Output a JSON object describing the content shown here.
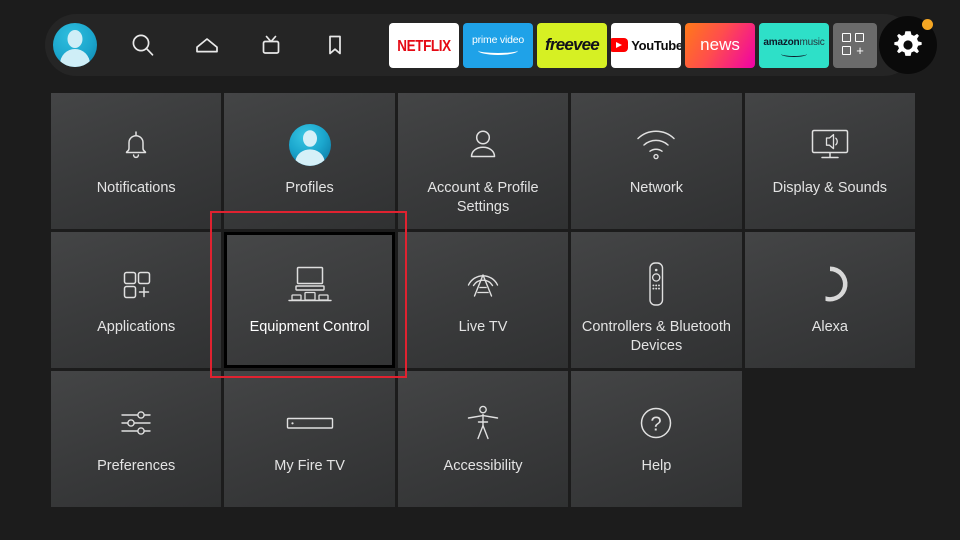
{
  "nav": {
    "profile_icon": "profile-avatar",
    "items": [
      {
        "name": "search-icon",
        "label": "Search"
      },
      {
        "name": "home-icon",
        "label": "Home"
      },
      {
        "name": "live-tv-icon",
        "label": "Live TV"
      },
      {
        "name": "bookmark-icon",
        "label": "Watchlist"
      }
    ],
    "apps": [
      {
        "name": "netflix",
        "label": "NETFLIX",
        "bg": "#ffffff",
        "fg": "#e50914"
      },
      {
        "name": "prime-video",
        "label": "prime video",
        "bg": "#1fa2e8",
        "fg": "#ffffff"
      },
      {
        "name": "freevee",
        "label": "freevee",
        "bg": "#d6f023",
        "fg": "#12121a"
      },
      {
        "name": "youtube",
        "label": "YouTube",
        "bg": "#ffffff",
        "fg": "#0b0b0b"
      },
      {
        "name": "news",
        "label": "news",
        "bg": "#ff4d4d",
        "fg": "#ffffff"
      },
      {
        "name": "amazon-music",
        "label_bold": "amazon",
        "label_light": "music",
        "bg": "#2ee0c8",
        "fg": "#0d1b2a"
      },
      {
        "name": "app-library",
        "label": "",
        "bg": "#6b6b6b",
        "fg": "#ffffff"
      }
    ],
    "settings": {
      "label": "Settings",
      "has_notification_dot": true,
      "dot_color": "#f5a623"
    }
  },
  "grid": {
    "rows": [
      [
        {
          "id": "notifications",
          "label": "Notifications",
          "icon": "bell-icon",
          "selected": false
        },
        {
          "id": "profiles",
          "label": "Profiles",
          "icon": "profile-avatar-icon",
          "selected": false
        },
        {
          "id": "account-profile-settings",
          "label": "Account & Profile Settings",
          "icon": "person-icon",
          "selected": false
        },
        {
          "id": "network",
          "label": "Network",
          "icon": "wifi-icon",
          "selected": false
        },
        {
          "id": "display-sounds",
          "label": "Display & Sounds",
          "icon": "tv-speaker-icon",
          "selected": false
        }
      ],
      [
        {
          "id": "applications",
          "label": "Applications",
          "icon": "app-grid-plus-icon",
          "selected": false
        },
        {
          "id": "equipment-control",
          "label": "Equipment Control",
          "icon": "tv-devices-icon",
          "selected": true
        },
        {
          "id": "live-tv",
          "label": "Live TV",
          "icon": "antenna-icon",
          "selected": false
        },
        {
          "id": "controllers-bluetooth-devices",
          "label": "Controllers & Bluetooth Devices",
          "icon": "remote-icon",
          "selected": false
        },
        {
          "id": "alexa",
          "label": "Alexa",
          "icon": "alexa-ring-icon",
          "selected": false
        }
      ],
      [
        {
          "id": "preferences",
          "label": "Preferences",
          "icon": "sliders-icon",
          "selected": false
        },
        {
          "id": "my-fire-tv",
          "label": "My Fire TV",
          "icon": "fire-tv-stick-icon",
          "selected": false
        },
        {
          "id": "accessibility",
          "label": "Accessibility",
          "icon": "accessibility-icon",
          "selected": false
        },
        {
          "id": "help",
          "label": "Help",
          "icon": "question-mark-icon",
          "selected": false
        },
        {
          "id": "empty",
          "label": "",
          "icon": "",
          "selected": false
        }
      ]
    ]
  },
  "annotation": {
    "color": "#e02230",
    "target": "equipment-control"
  }
}
